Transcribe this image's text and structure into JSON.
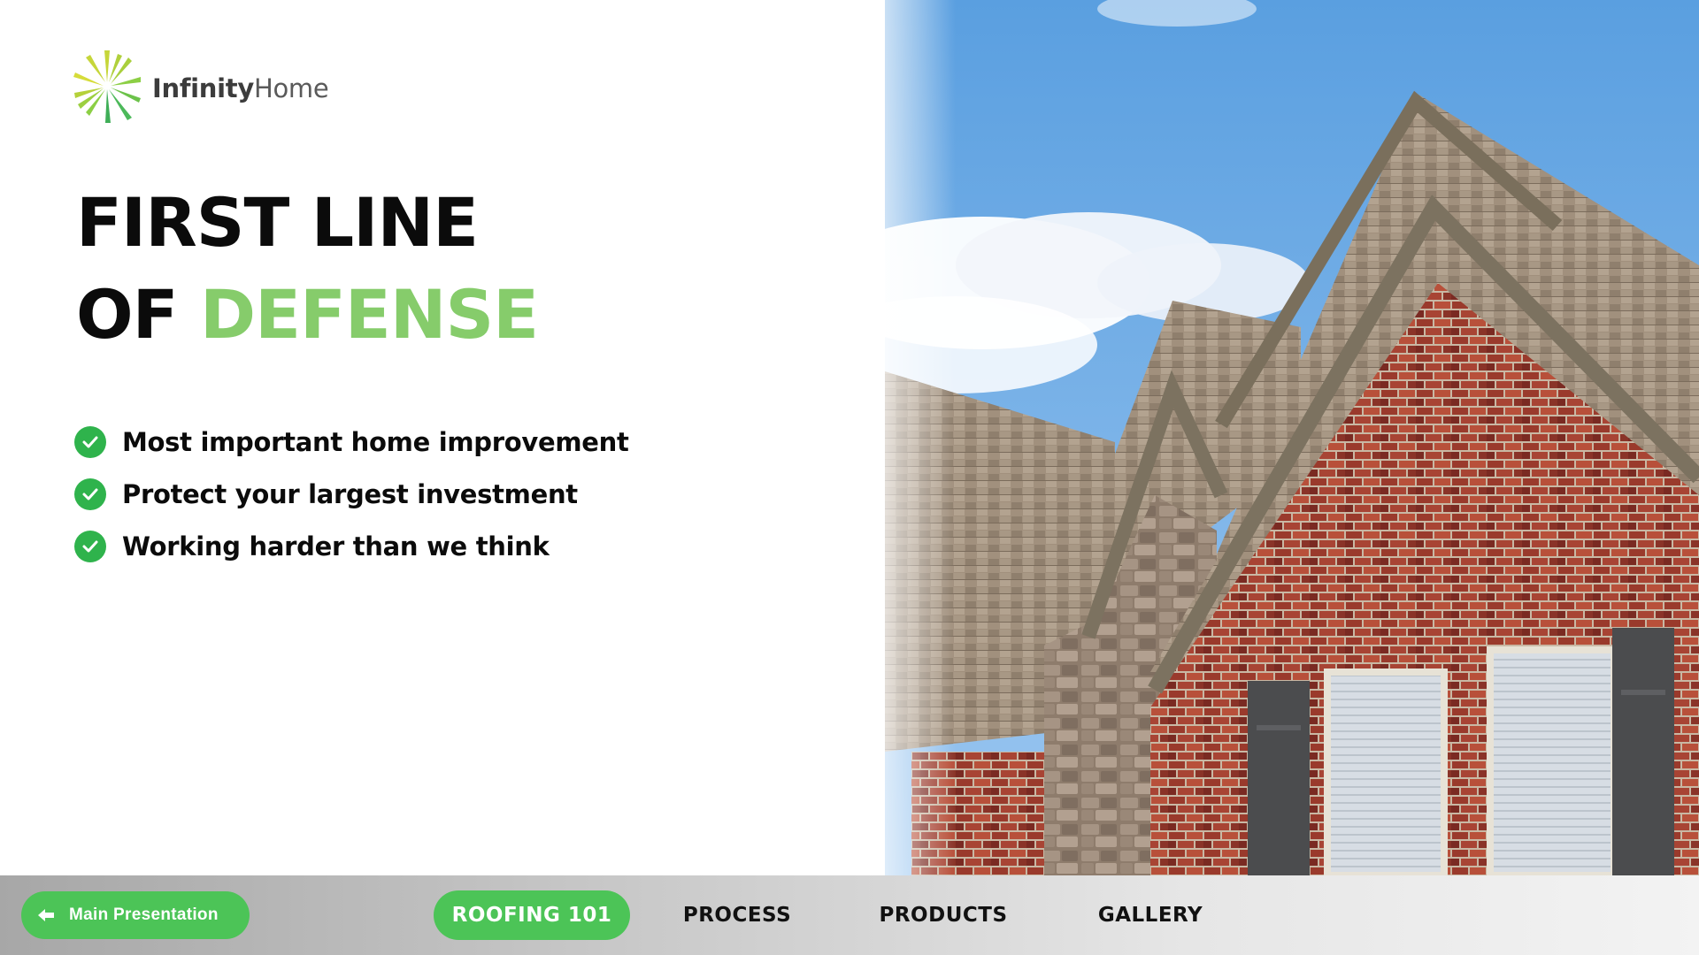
{
  "brand": {
    "name_part1": "Infinity",
    "name_part2": "Home",
    "logo_icon": "starburst-logo-icon"
  },
  "headline": {
    "line1": "FIRST LINE",
    "line2_prefix": "OF",
    "line2_accent": "DEFENSE"
  },
  "bullets": [
    {
      "icon": "check-circle-icon",
      "text": "Most important home improvement"
    },
    {
      "icon": "check-circle-icon",
      "text": "Protect your largest investment"
    },
    {
      "icon": "check-circle-icon",
      "text": "Working harder than we think"
    }
  ],
  "nav": {
    "back_button": {
      "icon": "arrow-left-icon",
      "label": "Main Presentation"
    },
    "tabs": [
      {
        "label": "ROOFING 101",
        "active": true
      },
      {
        "label": "PROCESS",
        "active": false
      },
      {
        "label": "PRODUCTS",
        "active": false
      },
      {
        "label": "GALLERY",
        "active": false
      }
    ]
  },
  "colors": {
    "accent_green": "#86cc6b",
    "button_green": "#4cc457",
    "check_green": "#2fb34c",
    "text_dark": "#0b0b0b"
  }
}
